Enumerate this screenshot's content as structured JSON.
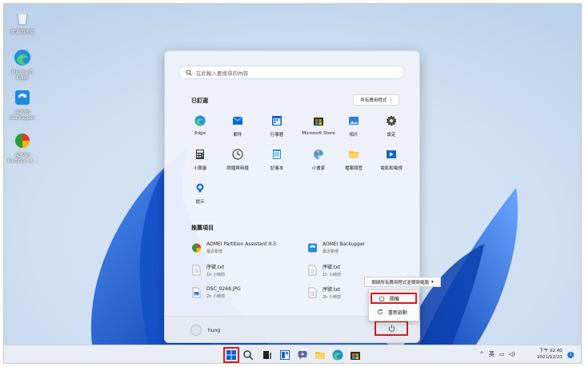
{
  "desktop": {
    "icons": [
      {
        "label": "資源回收筒",
        "icon": "recycle-bin-icon"
      },
      {
        "label": "Microsoft Edge",
        "icon": "edge-icon"
      },
      {
        "label": "AOMEI Backupper",
        "icon": "aomei-backupper-icon"
      },
      {
        "label": "AOMEI Partition A...",
        "icon": "aomei-partition-icon"
      }
    ]
  },
  "start_menu": {
    "search_placeholder": "在此輸入要搜尋的內容",
    "pinned_title": "已釘選",
    "all_apps_label": "所有應用程式",
    "pinned": [
      {
        "label": "Edge",
        "icon": "edge-icon"
      },
      {
        "label": "郵件",
        "icon": "mail-icon"
      },
      {
        "label": "行事曆",
        "icon": "calendar-icon"
      },
      {
        "label": "Microsoft Store",
        "icon": "store-icon"
      },
      {
        "label": "相片",
        "icon": "photos-icon"
      },
      {
        "label": "設定",
        "icon": "settings-icon"
      },
      {
        "label": "小算盤",
        "icon": "calculator-icon"
      },
      {
        "label": "鬧鐘與時鐘",
        "icon": "clock-icon"
      },
      {
        "label": "記事本",
        "icon": "notepad-icon"
      },
      {
        "label": "小畫家",
        "icon": "paint-icon"
      },
      {
        "label": "檔案總管",
        "icon": "file-explorer-icon"
      },
      {
        "label": "電影和電視",
        "icon": "movies-icon"
      },
      {
        "label": "提示",
        "icon": "tips-icon"
      }
    ],
    "recommended_title": "推薦項目",
    "recommended": [
      {
        "name": "AOMEI Partition Assistant 9.5",
        "sub": "最近新增",
        "icon": "aomei-partition-icon"
      },
      {
        "name": "AOMEI Backupper",
        "sub": "最近新增",
        "icon": "aomei-backupper-icon"
      },
      {
        "name": "序號.txt",
        "sub": "1h 小時前",
        "icon": "text-file-icon"
      },
      {
        "name": "序號.txt",
        "sub": "1h 小時前",
        "icon": "text-file-icon"
      },
      {
        "name": "DSC_0268.JPG",
        "sub": "2h 小時前",
        "icon": "image-file-icon"
      },
      {
        "name": "序號.txt",
        "sub": "2h 小時前",
        "icon": "text-file-icon"
      }
    ],
    "user_name": "hung"
  },
  "power_menu": {
    "tooltip": "關閉所有應用程式並關閉電腦",
    "shutdown_label": "關機",
    "restart_label": "重新啟動"
  },
  "taskbar": {
    "tray_text": "英",
    "time": "下午 02:40",
    "date": "2021/12/23",
    "notifications": "1"
  },
  "colors": {
    "accent": "#0a5ed7",
    "highlight": "#e0161d"
  }
}
